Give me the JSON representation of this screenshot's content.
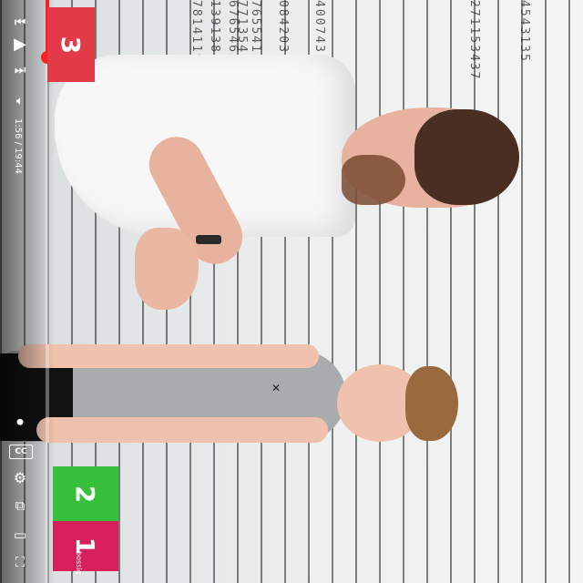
{
  "player": {
    "time": "1:56 / 19:44",
    "progress_fraction": 0.099,
    "controls": {
      "prev_icon": "skip-previous-icon",
      "play_icon": "play-icon",
      "next_icon": "skip-next-icon",
      "volume_icon": "volume-icon",
      "captions_label": "CC",
      "settings_icon": "gear-icon",
      "miniplayer_icon": "miniplayer-icon",
      "theater_icon": "theater-icon",
      "fullscreen_icon": "fullscreen-icon"
    },
    "accent_color": "#ff1f1f"
  },
  "overlay": {
    "score_top": "3",
    "score_green": "2",
    "score_red": "1",
    "badge_text": "bossig"
  },
  "wall_text": [
    "781411954",
    "139138129238",
    "67654653845",
    "765541354",
    "771354",
    "08420381",
    "4007431",
    "271153437",
    "4543135"
  ]
}
